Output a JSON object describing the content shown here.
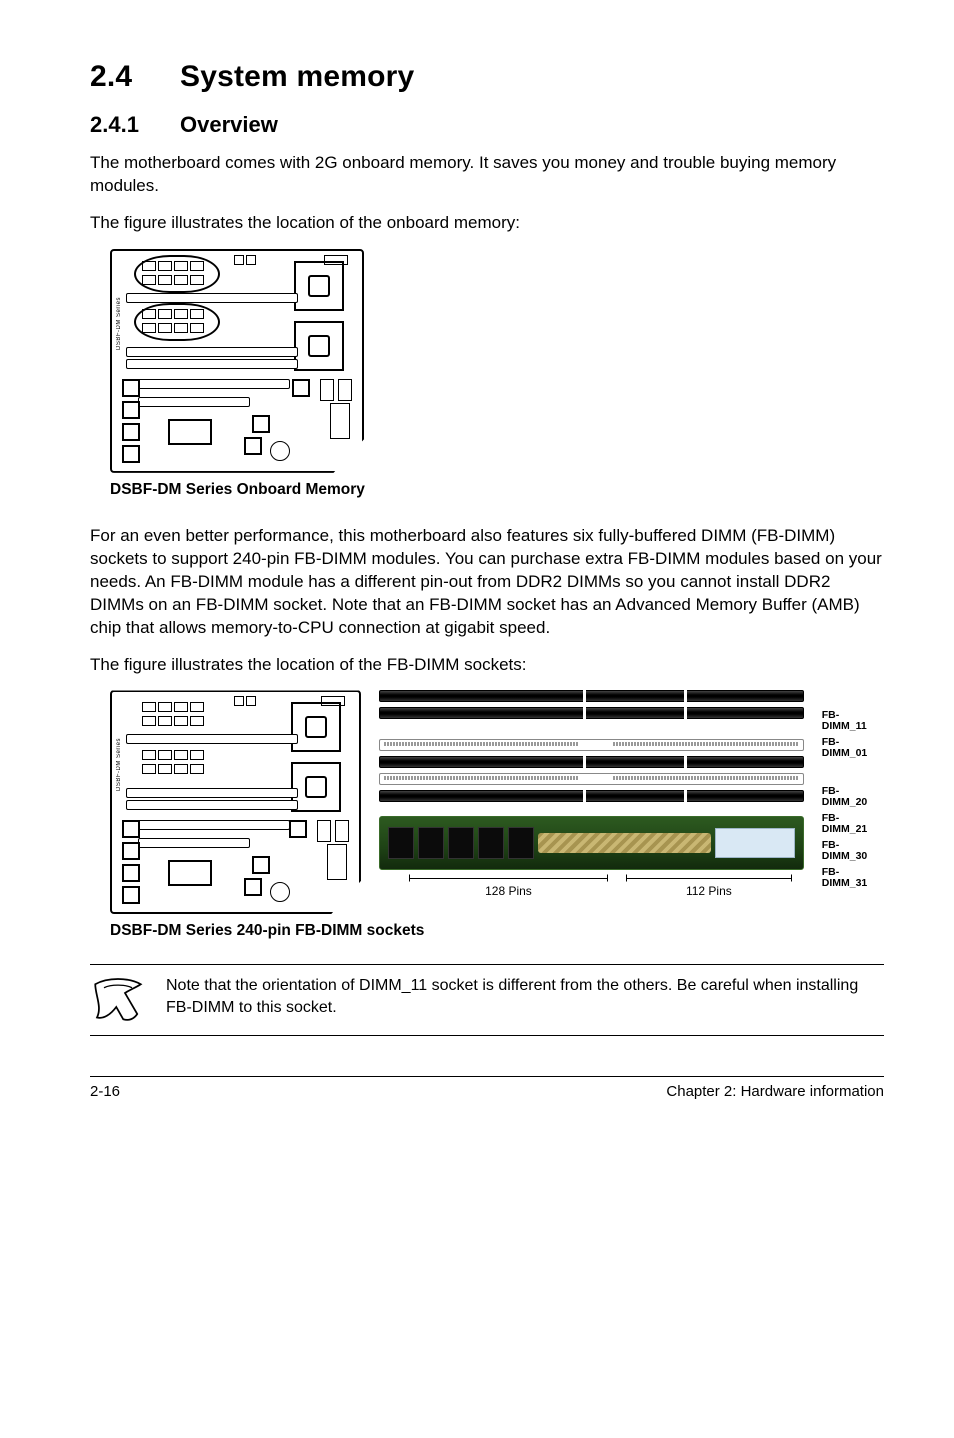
{
  "section_number": "2.4",
  "section_title": "System memory",
  "sub_number": "2.4.1",
  "sub_title": "Overview",
  "p1": "The motherboard comes with 2G onboard memory. It saves you money and trouble buying memory modules.",
  "p2": "The figure illustrates the location of the onboard memory:",
  "fig1_caption": "DSBF-DM Series Onboard Memory",
  "p3": "For an even better performance, this motherboard also features six fully-buffered DIMM (FB-DIMM) sockets to support 240-pin FB-DIMM modules. You can purchase extra FB-DIMM modules based on your needs. An FB-DIMM module has a different pin-out from DDR2 DIMMs so you cannot install DDR2 DIMMs on an FB-DIMM socket. Note that an FB-DIMM socket has an Advanced Memory Buffer (AMB) chip that allows memory-to-CPU connection at gigabit speed.",
  "p4": "The figure illustrates the location of the FB-DIMM sockets:",
  "dimm_labels": {
    "grp1": [
      "FB-DIMM_11",
      "FB-DIMM_01"
    ],
    "grp2": [
      "FB-DIMM_20",
      "FB-DIMM_21",
      "FB-DIMM_30",
      "FB-DIMM_31"
    ]
  },
  "pins_left": "128 Pins",
  "pins_right": "112 Pins",
  "fig2_caption": "DSBF-DM Series 240-pin FB-DIMM sockets",
  "note_text": "Note that the orientation of DIMM_11 socket is different from the others. Be careful when installing FB-DIMM to this socket.",
  "footer_left": "2-16",
  "footer_right": "Chapter 2: Hardware information",
  "vertical_label": "DSBF-DM Series"
}
